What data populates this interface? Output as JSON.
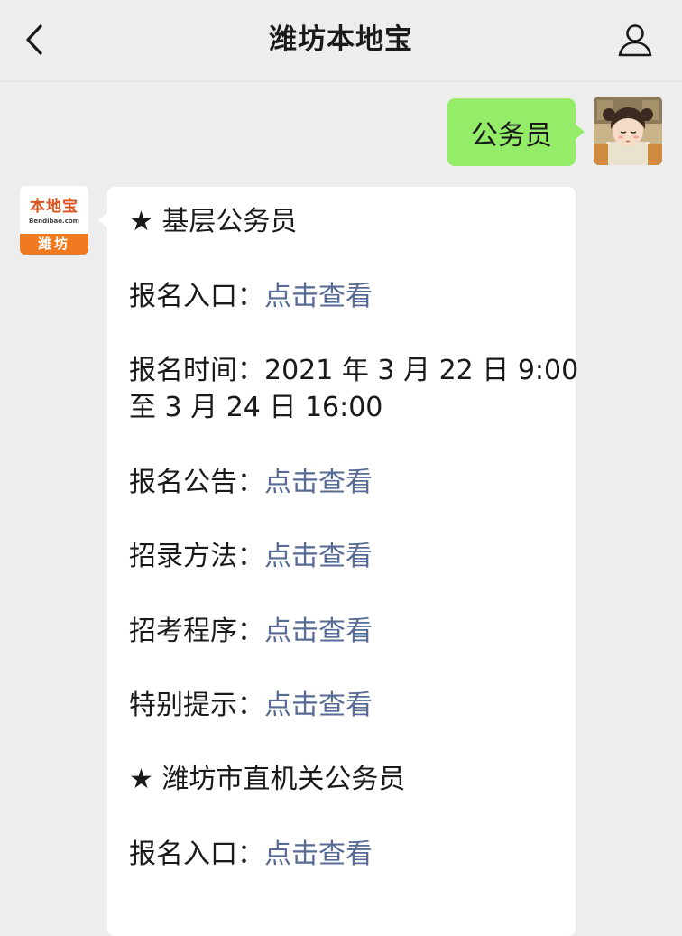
{
  "header": {
    "title": "潍坊本地宝",
    "back_icon": "chevron-left-icon",
    "profile_icon": "person-icon"
  },
  "user_message": {
    "text": "公务员",
    "bubble_color": "#95ec69"
  },
  "bot": {
    "logo_top": "本地宝",
    "logo_url": "Bendibao.com",
    "logo_city": "潍坊",
    "logo_color": "#f07a1f"
  },
  "reply": {
    "section1_title": "★ 基层公务员",
    "line1_label": "报名入口：",
    "line1_link": "点击查看",
    "time_line1": "报名时间：2021 年 3 月 22 日 9:00",
    "time_line2": "至 3 月 24 日 16:00",
    "line2_label": "报名公告：",
    "line2_link": "点击查看",
    "line3_label": "招录方法：",
    "line3_link": "点击查看",
    "line4_label": "招考程序：",
    "line4_link": "点击查看",
    "line5_label": "特别提示：",
    "line5_link": "点击查看",
    "section2_title": "★ 潍坊市直机关公务员",
    "line6_label": "报名入口：",
    "line6_link": "点击查看",
    "link_color": "#576b95"
  }
}
